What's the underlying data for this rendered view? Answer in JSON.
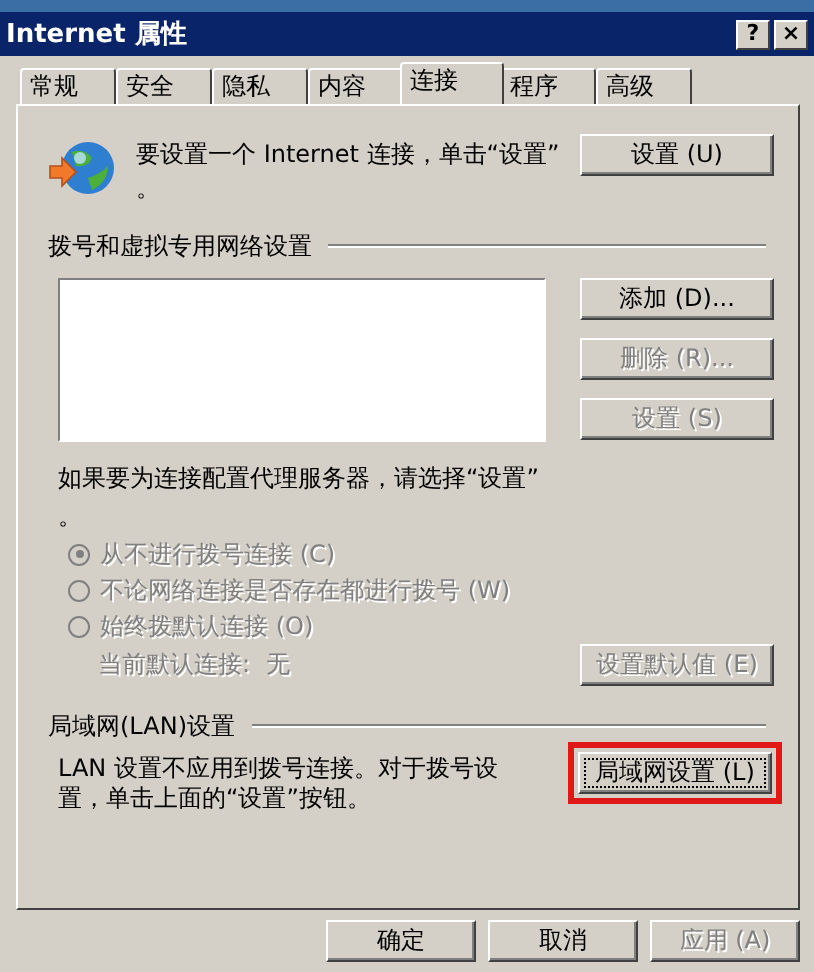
{
  "window": {
    "title": "Internet 属性",
    "help_button": "?",
    "close_button": "×"
  },
  "tabs": [
    {
      "label": "常规",
      "selected": false
    },
    {
      "label": "安全",
      "selected": false
    },
    {
      "label": "隐私",
      "selected": false
    },
    {
      "label": "内容",
      "selected": false
    },
    {
      "label": "连接",
      "selected": true
    },
    {
      "label": "程序",
      "selected": false
    },
    {
      "label": "高级",
      "selected": false
    }
  ],
  "intro": {
    "text": "要设置一个 Internet 连接，单击“设置”\n。",
    "button": {
      "label": "设置 (U)",
      "disabled": false
    }
  },
  "dialup": {
    "title": "拨号和虚拟专用网络设置",
    "buttons": [
      {
        "label": "添加 (D)...",
        "disabled": false
      },
      {
        "label": "删除 (R)...",
        "disabled": true
      },
      {
        "label": "设置 (S)",
        "disabled": true
      }
    ]
  },
  "proxy_hint": "如果要为连接配置代理服务器，请选择“设置”\n。",
  "dial_options": [
    {
      "label": "从不进行拨号连接 (C)",
      "selected": true,
      "disabled": true
    },
    {
      "label": "不论网络连接是否存在都进行拨号 (W)",
      "selected": false,
      "disabled": true
    },
    {
      "label": "始终拨默认连接 (O)",
      "selected": false,
      "disabled": true
    }
  ],
  "current_default": {
    "label": "当前默认连接:",
    "value": "无",
    "disabled": true
  },
  "set_default_button": {
    "label": "设置默认值 (E)",
    "disabled": true
  },
  "lan": {
    "title": "局域网(LAN)设置",
    "text": "LAN 设置不应用到拨号连接。对于拨号设置，单击上面的“设置”按钮。",
    "button": {
      "label": "局域网设置 (L)",
      "disabled": false,
      "focused": true,
      "highlighted": true
    }
  },
  "footer_buttons": [
    {
      "label": "确定",
      "disabled": false
    },
    {
      "label": "取消",
      "disabled": false
    },
    {
      "label": "应用 (A)",
      "disabled": true
    }
  ]
}
